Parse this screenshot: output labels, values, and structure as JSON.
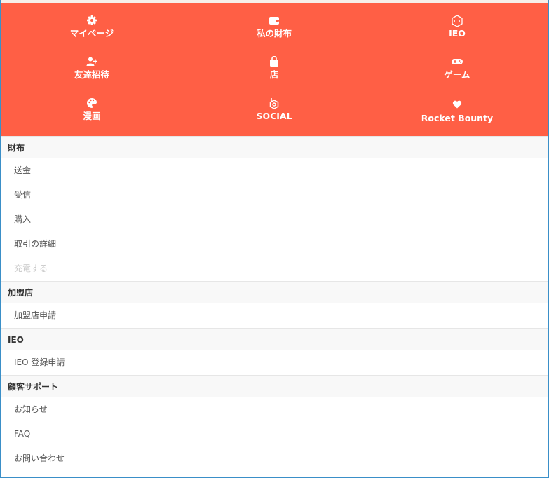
{
  "nav_grid": [
    {
      "label": "マイページ",
      "icon": "gear-icon"
    },
    {
      "label": "私の財布",
      "icon": "wallet-icon"
    },
    {
      "label": "IEO",
      "icon": "ieo-hexagon-icon"
    },
    {
      "label": "友達招待",
      "icon": "user-plus-icon"
    },
    {
      "label": "店",
      "icon": "shopping-bag-icon"
    },
    {
      "label": "ゲーム",
      "icon": "gamepad-icon"
    },
    {
      "label": "漫画",
      "icon": "palette-icon"
    },
    {
      "label": "SOCIAL",
      "icon": "social-logo-icon"
    },
    {
      "label": "Rocket Bounty",
      "icon": "heart-icon"
    }
  ],
  "sections": [
    {
      "title": "財布",
      "items": [
        "送金",
        "受信",
        "購入",
        "取引の詳細",
        "充電する"
      ]
    },
    {
      "title": "加盟店",
      "items": [
        "加盟店申請"
      ]
    },
    {
      "title": "IEO",
      "items": [
        "IEO 登録申請"
      ]
    },
    {
      "title": "顧客サポート",
      "items": [
        "お知らせ",
        "FAQ",
        "お問い合わせ"
      ]
    }
  ],
  "colors": {
    "accent": "#ff5f45",
    "section_bg": "#f8f8f8",
    "disabled_text": "#c8c8c8"
  }
}
